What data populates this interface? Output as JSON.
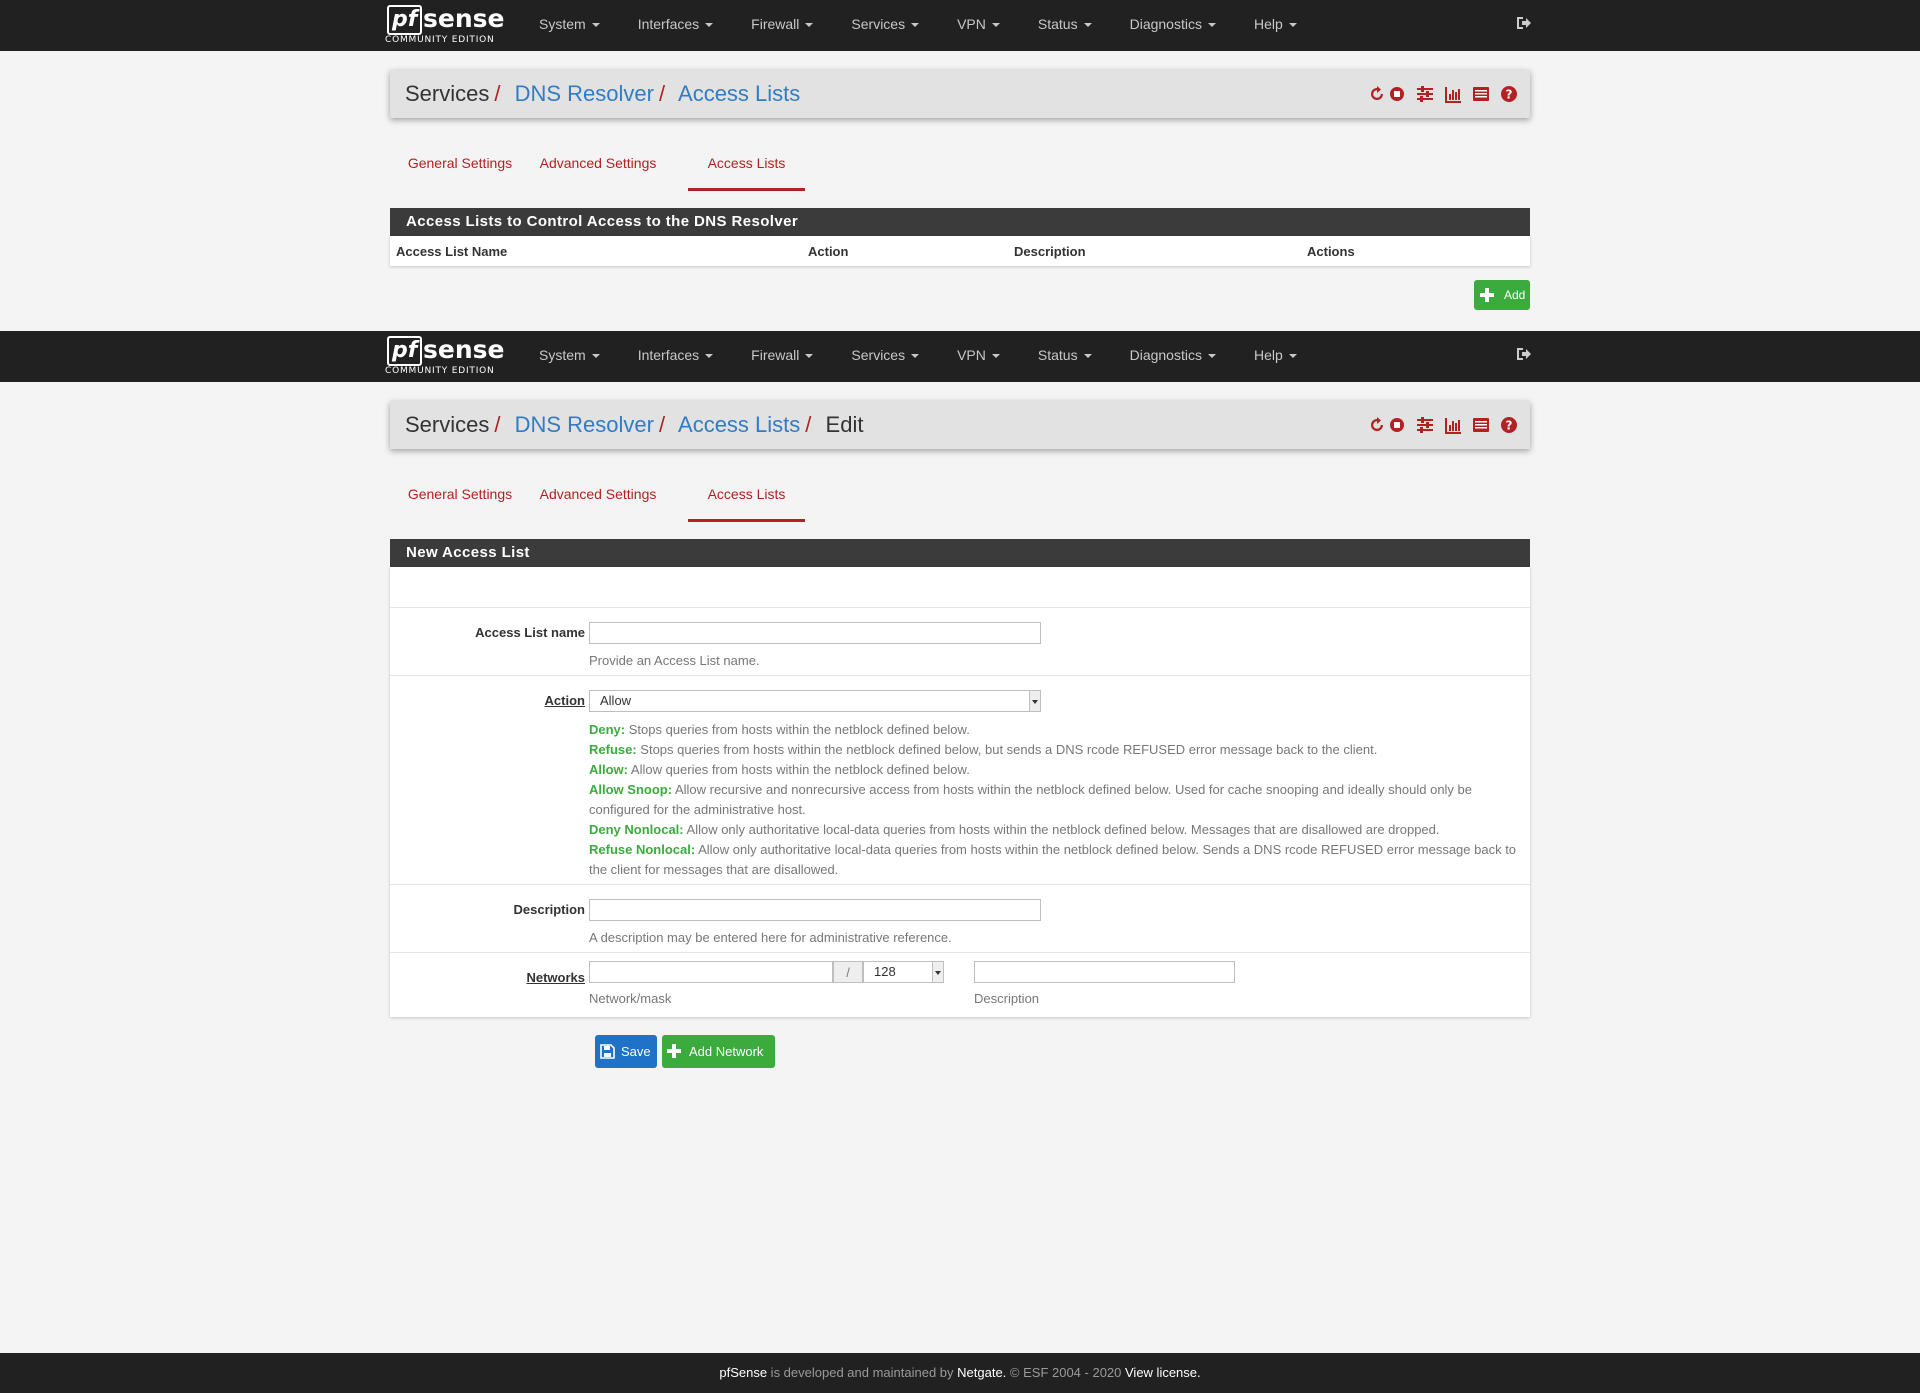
{
  "nav": {
    "logo_main_pf": "pf",
    "logo_main_sense": "sense",
    "logo_sub": "COMMUNITY EDITION",
    "items": [
      "System",
      "Interfaces",
      "Firewall",
      "Services",
      "VPN",
      "Status",
      "Diagnostics",
      "Help"
    ],
    "logout_icon": "sign-out-icon"
  },
  "screen1": {
    "breadcrumb": {
      "root": "Services",
      "level1": "DNS Resolver",
      "level2": "Access Lists"
    },
    "tabs": [
      "General Settings",
      "Advanced Settings",
      "Access Lists"
    ],
    "active_tab": "Access Lists",
    "section_title": "Access Lists to Control Access to the DNS Resolver",
    "columns": [
      "Access List Name",
      "Action",
      "Description",
      "Actions"
    ],
    "add_label": "Add"
  },
  "screen2": {
    "breadcrumb": {
      "root": "Services",
      "level1": "DNS Resolver",
      "level2": "Access Lists",
      "level3": "Edit"
    },
    "tabs": [
      "General Settings",
      "Advanced Settings",
      "Access Lists"
    ],
    "active_tab": "Access Lists",
    "section_title": "New Access List",
    "name": {
      "label": "Access List name",
      "value": "",
      "help": "Provide an Access List name."
    },
    "action": {
      "label": "Action",
      "selected": "Allow",
      "help": [
        {
          "term": "Deny:",
          "text": " Stops queries from hosts within the netblock defined below."
        },
        {
          "term": "Refuse:",
          "text": " Stops queries from hosts within the netblock defined below, but sends a DNS rcode REFUSED error message back to the client."
        },
        {
          "term": "Allow:",
          "text": " Allow queries from hosts within the netblock defined below."
        },
        {
          "term": "Allow Snoop:",
          "text": " Allow recursive and nonrecursive access from hosts within the netblock defined below. Used for cache snooping and ideally should only be configured for the administrative host."
        },
        {
          "term": "Deny Nonlocal:",
          "text": " Allow only authoritative local-data queries from hosts within the netblock defined below. Messages that are disallowed are dropped."
        },
        {
          "term": "Refuse Nonlocal:",
          "text": " Allow only authoritative local-data queries from hosts within the netblock defined below. Sends a DNS rcode REFUSED error message back to the client for messages that are disallowed."
        }
      ]
    },
    "description": {
      "label": "Description",
      "value": "",
      "help": "A description may be entered here for administrative reference."
    },
    "networks": {
      "label": "Networks",
      "network_value": "",
      "slash": "/",
      "mask": "128",
      "description_value": "",
      "network_help": "Network/mask",
      "description_help": "Description"
    },
    "save_label": "Save",
    "add_network_label": "Add Network"
  },
  "footer": {
    "brand": "pfSense",
    "middle": " is developed and maintained by ",
    "company": "Netgate.",
    "copyright": " © ESF 2004 - 2020 ",
    "license": "View license."
  },
  "colors": {
    "nav_bg": "#212121",
    "accent_red": "#b22222",
    "link_blue": "#317cc4",
    "btn_green": "#3cab3e",
    "btn_blue": "#1e73c8"
  }
}
